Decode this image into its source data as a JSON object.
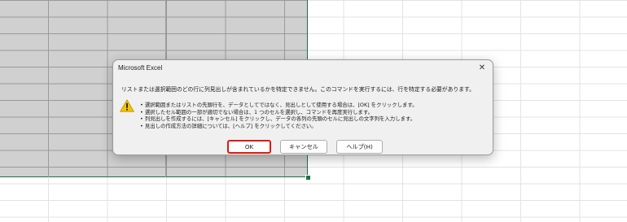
{
  "dialog": {
    "title": "Microsoft Excel",
    "close_glyph": "✕",
    "message": "リストまたは選択範囲のどの行に列見出しが含まれているかを特定できません。このコマンドを実行するには、行を特定する必要があります。",
    "bullets": [
      "選択範囲またはリストの先頭行を、データとしてではなく、見出しとして使用する場合は、[OK] をクリックします。",
      "選択したセル範囲の一部が適切でない場合は、1 つのセルを選択し、コマンドを再度実行します。",
      "列見出しを作成するには、[キャンセル] をクリックし、データの各列の先頭のセルに見出しの文字列を入力します。",
      "見出しの作成方法の詳細については、[ヘルプ] をクリックしてください。"
    ],
    "icon": "warning-icon",
    "buttons": {
      "ok": "OK",
      "cancel": "キャンセル",
      "help": "ヘルプ(H)"
    }
  },
  "colors": {
    "warning": "#f5c400",
    "highlight": "#e0190f",
    "selection": "#d0d0d0",
    "accent": "#1e7145"
  }
}
